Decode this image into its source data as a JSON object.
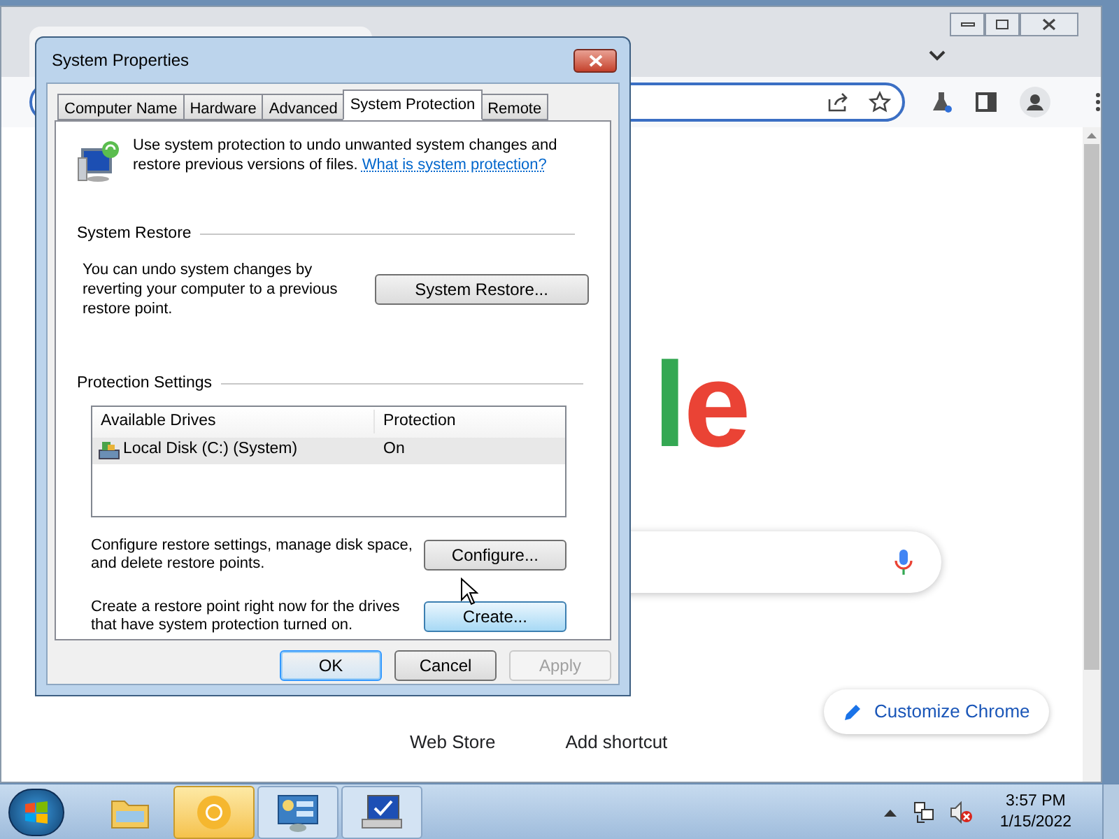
{
  "browser": {
    "logo_letters": [
      {
        "text": "l",
        "color": "#34a853"
      },
      {
        "text": "e",
        "color": "#ea4335"
      }
    ],
    "shortcuts": [
      "Web Store",
      "Add shortcut"
    ],
    "customize_button": "Customize Chrome"
  },
  "dialog": {
    "title": "System Properties",
    "tabs": [
      {
        "label": "Computer Name",
        "selected": false
      },
      {
        "label": "Hardware",
        "selected": false
      },
      {
        "label": "Advanced",
        "selected": false
      },
      {
        "label": "System Protection",
        "selected": true
      },
      {
        "label": "Remote",
        "selected": false
      }
    ],
    "intro": "Use system protection to undo unwanted system changes and restore previous versions of files.",
    "intro_link": "What is system protection?",
    "system_restore": {
      "heading": "System Restore",
      "text": "You can undo system changes by reverting your computer to a previous restore point.",
      "button": {
        "label": "System Restore...",
        "hovered": false
      }
    },
    "protection_settings": {
      "heading": "Protection Settings",
      "columns": [
        "Available Drives",
        "Protection"
      ],
      "rows": [
        {
          "drive": "Local Disk (C:) (System)",
          "protection": "On",
          "selected": true
        }
      ],
      "actions": [
        {
          "text": "Configure restore settings, manage disk space, and delete restore points.",
          "button": {
            "label": "Configure...",
            "hovered": false
          }
        },
        {
          "text": "Create a restore point right now for the drives that have system protection turned on.",
          "button": {
            "label": "Create...",
            "hovered": true
          }
        }
      ]
    },
    "buttons": [
      {
        "label": "OK",
        "default": true,
        "disabled": false
      },
      {
        "label": "Cancel",
        "default": false,
        "disabled": false
      },
      {
        "label": "Apply",
        "default": false,
        "disabled": true
      }
    ]
  },
  "taskbar": {
    "items": [
      {
        "kind": "explorer",
        "highlighted": false
      },
      {
        "kind": "chrome",
        "highlighted": true
      },
      {
        "kind": "control-panel",
        "highlighted": false
      },
      {
        "kind": "system",
        "highlighted": false
      }
    ],
    "time": "3:57 PM",
    "date": "1/15/2022"
  }
}
